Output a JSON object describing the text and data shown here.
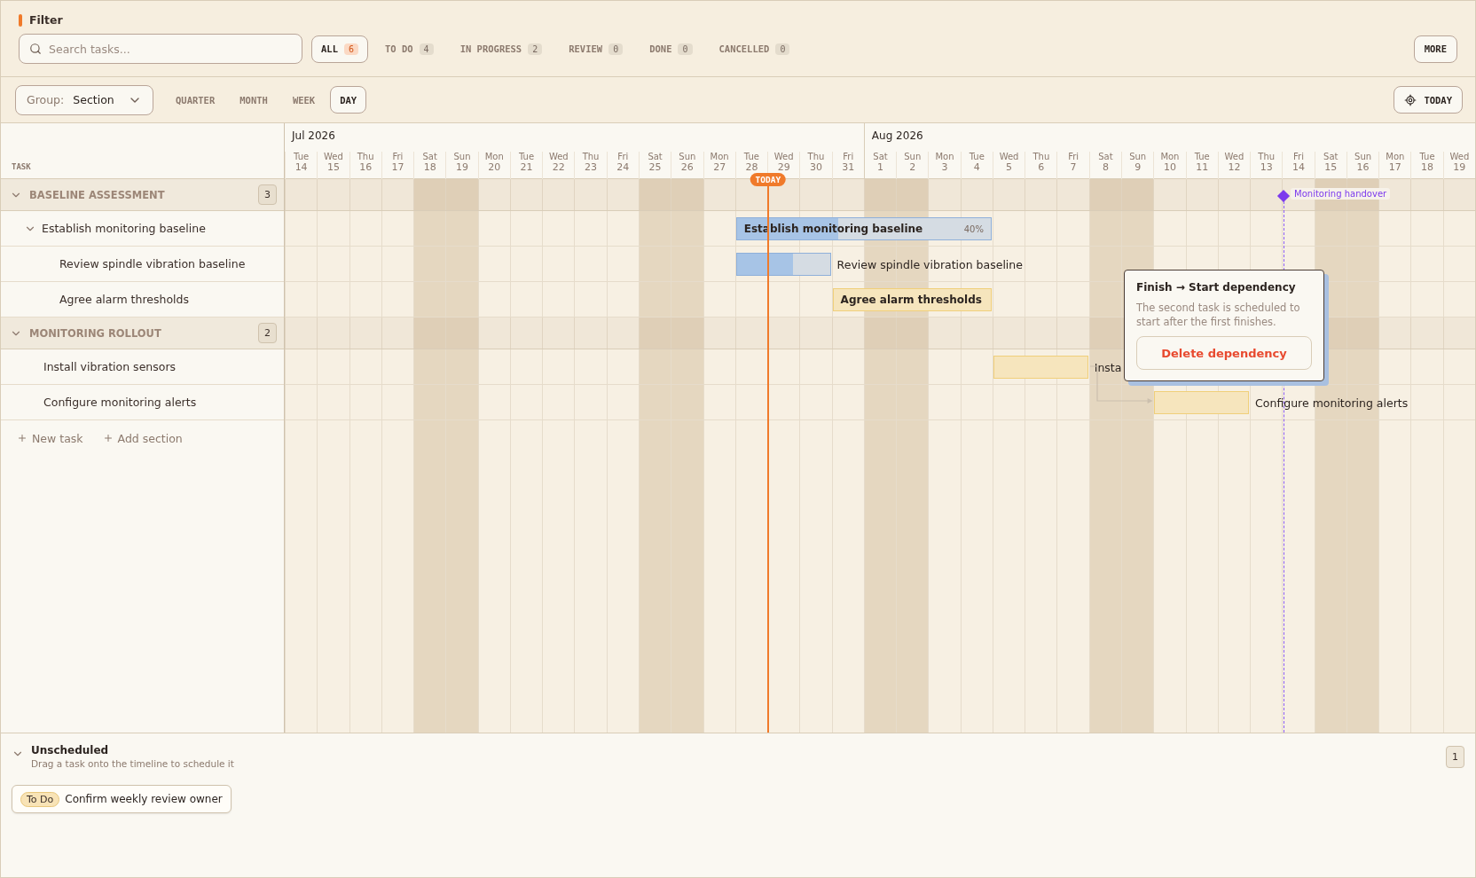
{
  "filter": {
    "title": "Filter",
    "search": {
      "placeholder": "Search tasks..."
    },
    "chips": [
      {
        "label": "ALL",
        "count": "6",
        "selected": true
      },
      {
        "label": "TO DO",
        "count": "4",
        "selected": false
      },
      {
        "label": "IN PROGRESS",
        "count": "2",
        "selected": false
      },
      {
        "label": "REVIEW",
        "count": "0",
        "selected": false
      },
      {
        "label": "DONE",
        "count": "0",
        "selected": false
      },
      {
        "label": "CANCELLED",
        "count": "0",
        "selected": false
      }
    ],
    "more": "MORE"
  },
  "toolbar": {
    "group": {
      "label": "Group:",
      "value": "Section"
    },
    "zooms": [
      {
        "label": "QUARTER",
        "selected": false
      },
      {
        "label": "MONTH",
        "selected": false
      },
      {
        "label": "WEEK",
        "selected": false
      },
      {
        "label": "DAY",
        "selected": true
      }
    ],
    "today_button": "TODAY"
  },
  "task_column": "TASK",
  "months": [
    {
      "label": "Jul 2026",
      "days": [
        {
          "dow": "Tue",
          "day": "14",
          "weekend": false
        },
        {
          "dow": "Wed",
          "day": "15",
          "weekend": false
        },
        {
          "dow": "Thu",
          "day": "16",
          "weekend": false
        },
        {
          "dow": "Fri",
          "day": "17",
          "weekend": false
        },
        {
          "dow": "Sat",
          "day": "18",
          "weekend": true
        },
        {
          "dow": "Sun",
          "day": "19",
          "weekend": true
        },
        {
          "dow": "Mon",
          "day": "20",
          "weekend": false
        },
        {
          "dow": "Tue",
          "day": "21",
          "weekend": false
        },
        {
          "dow": "Wed",
          "day": "22",
          "weekend": false
        },
        {
          "dow": "Thu",
          "day": "23",
          "weekend": false
        },
        {
          "dow": "Fri",
          "day": "24",
          "weekend": false
        },
        {
          "dow": "Sat",
          "day": "25",
          "weekend": true
        },
        {
          "dow": "Sun",
          "day": "26",
          "weekend": true
        },
        {
          "dow": "Mon",
          "day": "27",
          "weekend": false
        },
        {
          "dow": "Tue",
          "day": "28",
          "weekend": false
        },
        {
          "dow": "Wed",
          "day": "29",
          "weekend": false,
          "today": true
        },
        {
          "dow": "Thu",
          "day": "30",
          "weekend": false
        },
        {
          "dow": "Fri",
          "day": "31",
          "weekend": false
        }
      ]
    },
    {
      "label": "Aug 2026",
      "days": [
        {
          "dow": "Sat",
          "day": "1",
          "weekend": true
        },
        {
          "dow": "Sun",
          "day": "2",
          "weekend": true
        },
        {
          "dow": "Mon",
          "day": "3",
          "weekend": false
        },
        {
          "dow": "Tue",
          "day": "4",
          "weekend": false
        },
        {
          "dow": "Wed",
          "day": "5",
          "weekend": false
        },
        {
          "dow": "Thu",
          "day": "6",
          "weekend": false
        },
        {
          "dow": "Fri",
          "day": "7",
          "weekend": false
        },
        {
          "dow": "Sat",
          "day": "8",
          "weekend": true
        },
        {
          "dow": "Sun",
          "day": "9",
          "weekend": true
        },
        {
          "dow": "Mon",
          "day": "10",
          "weekend": false
        },
        {
          "dow": "Tue",
          "day": "11",
          "weekend": false
        },
        {
          "dow": "Wed",
          "day": "12",
          "weekend": false
        },
        {
          "dow": "Thu",
          "day": "13",
          "weekend": false
        },
        {
          "dow": "Fri",
          "day": "14",
          "weekend": false,
          "milestone": "Monitoring handover"
        },
        {
          "dow": "Sat",
          "day": "15",
          "weekend": true
        },
        {
          "dow": "Sun",
          "day": "16",
          "weekend": true
        },
        {
          "dow": "Mon",
          "day": "17",
          "weekend": false
        },
        {
          "dow": "Tue",
          "day": "18",
          "weekend": false
        },
        {
          "dow": "Wed",
          "day": "19",
          "weekend": false
        }
      ]
    }
  ],
  "today_marker": "TODAY",
  "sections": [
    {
      "title": "BASELINE ASSESSMENT",
      "count": "3",
      "expanded": true,
      "tasks": [
        {
          "title": "Establish monitoring baseline",
          "expanded": true,
          "kind": "in_progress",
          "bar_label": "Establish monitoring baseline",
          "label_inside": true,
          "level": 0.4,
          "percent": "40%",
          "children": [
            {
              "title": "Review spindle vibration baseline",
              "kind": "in_progress",
              "bar_label": "Review spindle vibration baseline",
              "label_inside": false,
              "level": 0.6
            },
            {
              "title": "Agree alarm thresholds",
              "kind": "todo",
              "bar_label": "Agree alarm thresholds",
              "label_inside": true
            }
          ]
        }
      ]
    },
    {
      "title": "MONITORING ROLLOUT",
      "count": "2",
      "expanded": true,
      "tasks": [
        {
          "title": "Install vibration sensors",
          "kind": "todo",
          "bar_label": "Insta",
          "label_inside": false
        },
        {
          "title": "Configure monitoring alerts",
          "kind": "todo",
          "bar_label": "Configure monitoring alerts",
          "label_inside": false
        }
      ]
    }
  ],
  "footer_actions": [
    "New task",
    "Add section"
  ],
  "dependency_popup": {
    "title": "Finish → Start dependency",
    "text": "The second task is scheduled to start after the first finishes.",
    "button": "Delete dependency"
  },
  "unscheduled": {
    "title": "Unscheduled",
    "subtitle": "Drag a task onto the timeline to schedule it",
    "count": "1",
    "expanded": true,
    "tasks": [
      {
        "status": "To Do",
        "title": "Confirm weekly review owner"
      }
    ]
  }
}
